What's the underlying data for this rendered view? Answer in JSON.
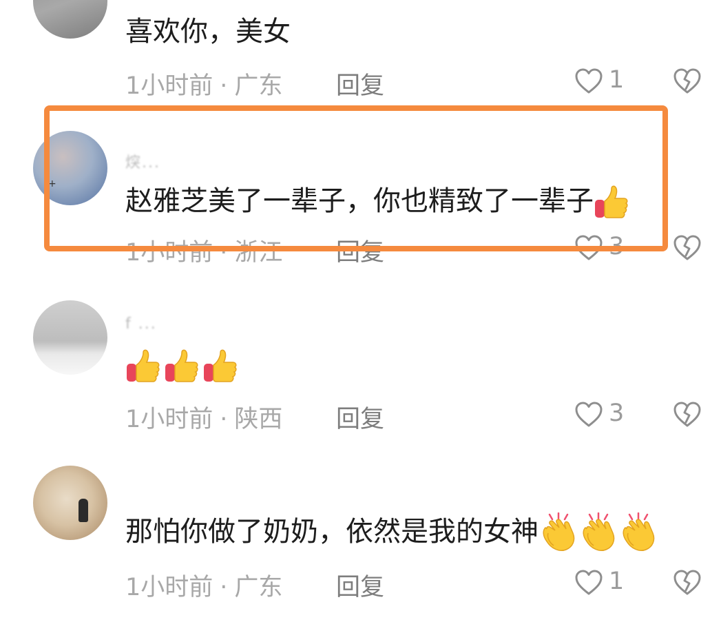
{
  "highlight_color": "#f58a3e",
  "comments": [
    {
      "username": "",
      "text": "喜欢你，美女",
      "emojis": [],
      "time": "1小时前",
      "location": "广东",
      "reply_label": "回复",
      "like_count": "1"
    },
    {
      "username": "㷝...",
      "text": "赵雅芝美了一辈子，你也精致了一辈子",
      "emojis": [
        "thumbs-up"
      ],
      "time": "1小时前",
      "location": "浙江",
      "reply_label": "回复",
      "like_count": "3",
      "highlighted": true
    },
    {
      "username": "f ...",
      "text": "",
      "emojis": [
        "thumbs-up",
        "thumbs-up",
        "thumbs-up"
      ],
      "time": "1小时前",
      "location": "陕西",
      "reply_label": "回复",
      "like_count": "3"
    },
    {
      "username": "",
      "text": "那怕你做了奶奶，依然是我的女神",
      "emojis": [
        "clapping-hands",
        "clapping-hands",
        "clapping-hands"
      ],
      "time": "1小时前",
      "location": "广东",
      "reply_label": "回复",
      "like_count": "1"
    }
  ],
  "icons": {
    "like": "heart-outline-icon",
    "dislike": "broken-heart-icon"
  }
}
